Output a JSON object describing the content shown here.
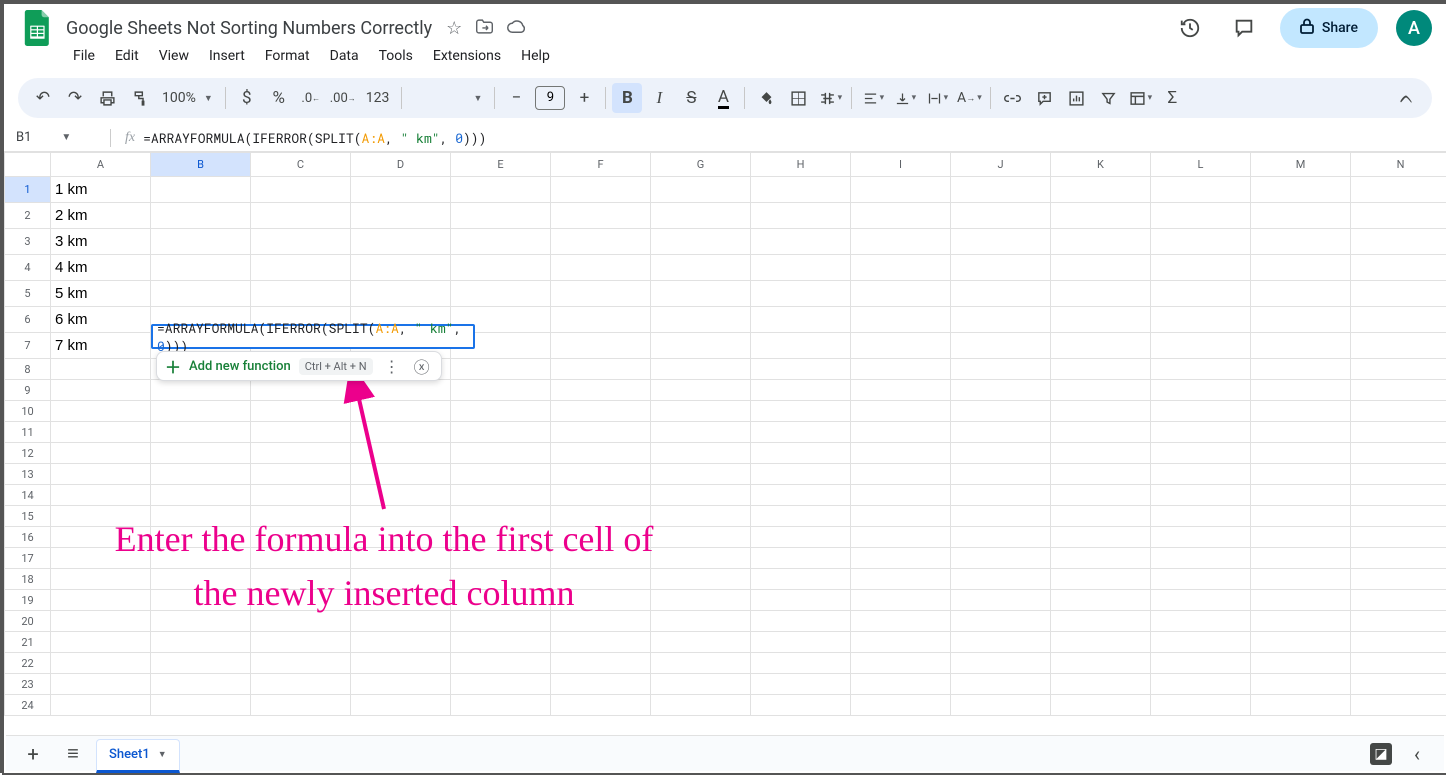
{
  "doc": {
    "title": "Google Sheets Not Sorting Numbers Correctly"
  },
  "menus": [
    "File",
    "Edit",
    "View",
    "Insert",
    "Format",
    "Data",
    "Tools",
    "Extensions",
    "Help"
  ],
  "share": {
    "label": "Share"
  },
  "avatar": {
    "initial": "A"
  },
  "toolbar": {
    "zoom": "100%",
    "font_size": "9"
  },
  "namebox": {
    "ref": "B1"
  },
  "formula": {
    "prefix": "=ARRAYFORMULA(IFERROR(SPLIT(",
    "ref": "A:A",
    "mid": ", ",
    "str": "\" km\"",
    "mid2": ", ",
    "num": "0",
    "suffix": ")))"
  },
  "columns": [
    "A",
    "B",
    "C",
    "D",
    "E",
    "F",
    "G",
    "H",
    "I",
    "J",
    "K",
    "L",
    "M",
    "N"
  ],
  "rows": [
    1,
    2,
    3,
    4,
    5,
    6,
    7,
    8,
    9,
    10,
    11,
    12,
    13,
    14,
    15,
    16,
    17,
    18,
    19,
    20,
    21,
    22,
    23,
    24
  ],
  "colA": [
    "1 km",
    "2 km",
    "3 km",
    "4 km",
    "5 km",
    "6 km",
    "7 km"
  ],
  "helper": {
    "label": "Add new function",
    "kbd": "Ctrl + Alt + N"
  },
  "annotation": {
    "text": "Enter the formula into the first cell of the newly inserted column"
  },
  "sheettab": {
    "name": "Sheet1"
  }
}
